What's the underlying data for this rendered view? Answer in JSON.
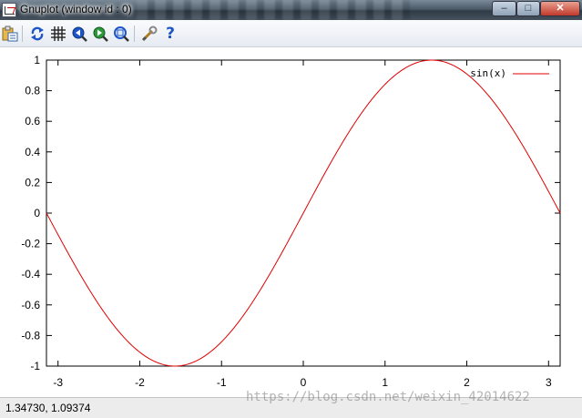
{
  "window": {
    "title": "Gnuplot (window id : 0)",
    "buttons": {
      "minimize": "–",
      "maximize": "□",
      "close": "✕"
    }
  },
  "toolbar": {
    "items": [
      {
        "icon": "copy-to-clipboard-icon"
      },
      {
        "icon": "replot-icon"
      },
      {
        "icon": "grid-icon"
      },
      {
        "icon": "previous-zoom-icon"
      },
      {
        "icon": "next-zoom-icon"
      },
      {
        "icon": "autoscale-icon"
      },
      {
        "icon": "options-icon"
      },
      {
        "icon": "help-icon"
      }
    ],
    "help_glyph": "?"
  },
  "status": {
    "coordinates": "1.34730,  1.09374"
  },
  "watermark": "https://blog.csdn.net/weixin_42014622",
  "colors": {
    "line": "#e00000",
    "accent_blue": "#1f56c7",
    "accent_green": "#2a9a3a"
  },
  "chart_data": {
    "type": "line",
    "function": "sin(x)",
    "xlim": [
      -3.14159,
      3.14159
    ],
    "ylim": [
      -1,
      1
    ],
    "x_ticks": [
      -3,
      -2,
      -1,
      0,
      1,
      2,
      3
    ],
    "x_tick_labels": [
      "-3",
      "-2",
      "-1",
      "0",
      "1",
      "2",
      "3"
    ],
    "y_ticks": [
      -1,
      -0.8,
      -0.6,
      -0.4,
      -0.2,
      0,
      0.2,
      0.4,
      0.6,
      0.8,
      1
    ],
    "y_tick_labels": [
      "-1",
      "-0.8",
      "-0.6",
      "-0.4",
      "-0.2",
      "0",
      "0.2",
      "0.4",
      "0.6",
      "0.8",
      "1"
    ],
    "series": [
      {
        "name": "sin(x)",
        "color": "#e00000"
      }
    ],
    "legend_position": "top-right",
    "grid": false,
    "title": "",
    "xlabel": "",
    "ylabel": ""
  }
}
